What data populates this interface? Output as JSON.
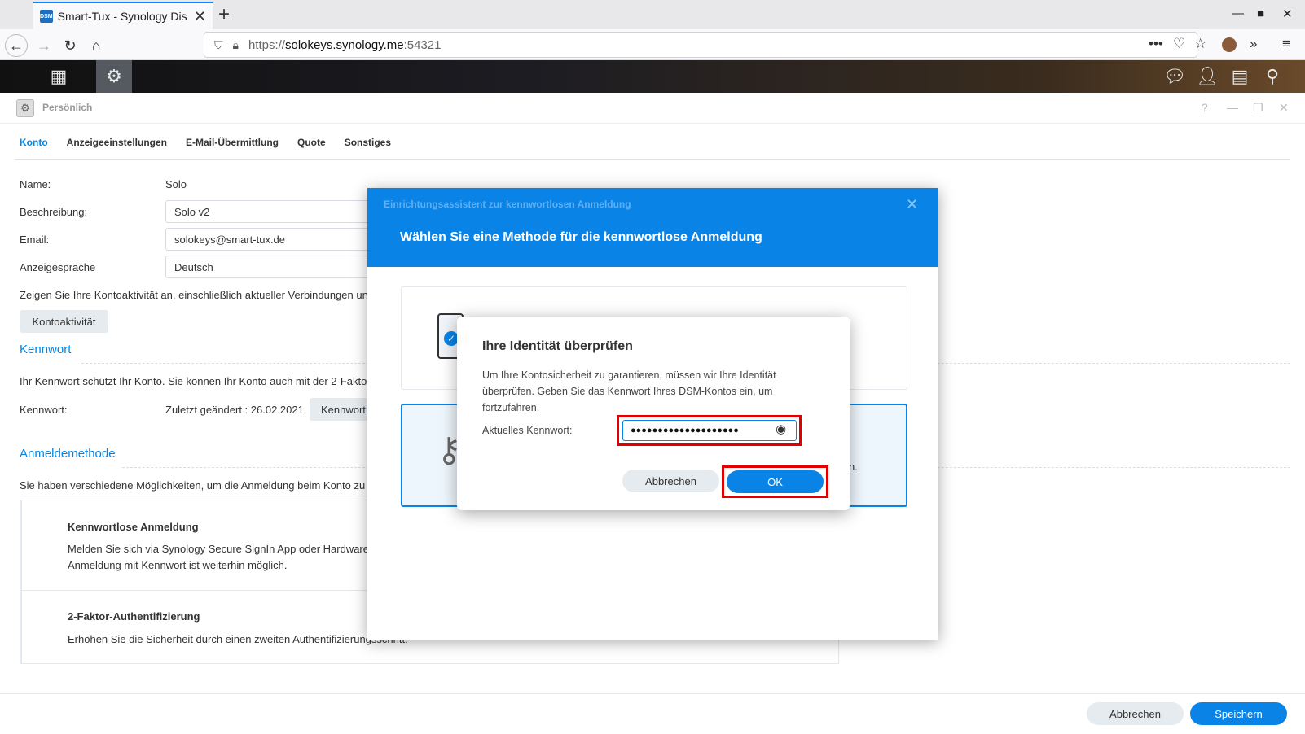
{
  "browser": {
    "tab_title": "Smart-Tux - Synology Dis",
    "favicon_text": "DSM",
    "url_prefix": "https://",
    "url_host": "solokeys.synology.me",
    "url_port": ":54321"
  },
  "window": {
    "title": "Persönlich"
  },
  "tabs": [
    "Konto",
    "Anzeigeeinstellungen",
    "E-Mail-Übermittlung",
    "Quote",
    "Sonstiges"
  ],
  "account": {
    "name_label": "Name:",
    "name_value": "Solo",
    "desc_label": "Beschreibung:",
    "desc_value": "Solo v2",
    "email_label": "Email:",
    "email_value": "solokeys@smart-tux.de",
    "lang_label": "Anzeigesprache",
    "lang_value": "Deutsch",
    "activity_text": "Zeigen Sie Ihre Kontoaktivität an, einschließlich aktueller Verbindungen un",
    "activity_button": "Kontoaktivität"
  },
  "password": {
    "section": "Kennwort",
    "text": "Ihr Kennwort schützt Ihr Konto. Sie können Ihr Konto auch mit der 2-Fakto",
    "label": "Kennwort:",
    "changed": "Zuletzt geändert : 26.02.2021",
    "button": "Kennwort"
  },
  "login": {
    "section": "Anmeldemethode",
    "text": "Sie haben verschiedene Möglichkeiten, um die Anmeldung beim Konto zu",
    "passwordless_title": "Kennwortlose Anmeldung",
    "passwordless_text1": "Melden Sie sich via Synology Secure SignIn App oder Hardware",
    "passwordless_text2": "Anmeldung mit Kennwort ist weiterhin möglich.",
    "twofa_title": "2-Faktor-Authentifizierung",
    "twofa_text": "Erhöhen Sie die Sicherheit durch einen zweiten Authentifizierungsschritt."
  },
  "wizard": {
    "subtitle": "Einrichtungsassistent zur kennwortlosen Anmeldung",
    "title": "Wählen Sie eine Methode für die kennwortlose Anmeldung",
    "card2_tail": "n."
  },
  "modal": {
    "title": "Ihre Identität überprüfen",
    "description": "Um Ihre Kontosicherheit zu garantieren, müssen wir Ihre Identität überprüfen. Geben Sie das Kennwort Ihres DSM-Kontos ein, um fortzufahren.",
    "password_label": "Aktuelles Kennwort:",
    "password_value": "●●●●●●●●●●●●●●●●●●●●",
    "cancel": "Abbrechen",
    "ok": "OK"
  },
  "footer": {
    "cancel": "Abbrechen",
    "save": "Speichern"
  },
  "colors": {
    "accent": "#0a83e6",
    "highlight": "#e10000"
  }
}
